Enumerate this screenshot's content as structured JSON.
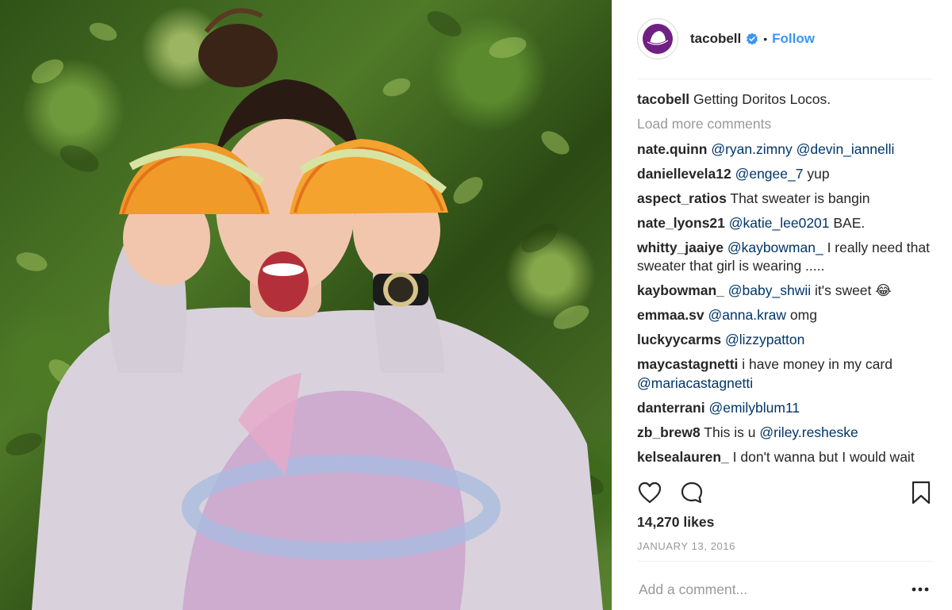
{
  "header": {
    "username": "tacobell",
    "follow_label": "Follow",
    "verified_color": "#3897f0"
  },
  "caption": {
    "user": "tacobell",
    "text": "Getting Doritos Locos."
  },
  "load_more_label": "Load more comments",
  "comments": [
    {
      "user": "nate.quinn",
      "mention": "@ryan.zimny @devin_iannelli",
      "text": ""
    },
    {
      "user": "daniellevela12",
      "mention": "@engee_7",
      "text": " yup"
    },
    {
      "user": "aspect_ratios",
      "mention": "",
      "text": " That sweater is bangin"
    },
    {
      "user": "nate_lyons21",
      "mention": "@katie_lee0201",
      "text": " BAE."
    },
    {
      "user": "whitty_jaaiye",
      "mention": "@kaybowman_",
      "text": " I really need that sweater that girl is wearing ....."
    },
    {
      "user": "kaybowman_",
      "mention": "@baby_shwii",
      "text": " it's sweet 😂"
    },
    {
      "user": "emmaa.sv",
      "mention": "@anna.kraw",
      "text": " omg"
    },
    {
      "user": "luckyycarms",
      "mention": "@lizzypatton",
      "text": ""
    },
    {
      "user": "maycastagnetti",
      "mention": "",
      "text": " i have money in my card",
      "mention_after": "@mariacastagnetti"
    },
    {
      "user": "danterrani",
      "mention": "@emilyblum11",
      "text": ""
    },
    {
      "user": "zb_brew8",
      "mention": "",
      "text": " This is u ",
      "mention_after": "@riley.resheske"
    },
    {
      "user": "kelsealauren_",
      "mention": "",
      "text": " I don't wanna but I would wait"
    }
  ],
  "actions": {
    "like_icon": "heart-icon",
    "comment_icon": "comment-icon",
    "save_icon": "bookmark-icon"
  },
  "likes": "14,270 likes",
  "date": "JANUARY 13, 2016",
  "add_comment": {
    "placeholder": "Add a comment...",
    "more_icon": "more-options-icon"
  },
  "colors": {
    "link": "#3897f0",
    "mention": "#003569",
    "muted": "#999999",
    "brand_purple": "#702082"
  }
}
